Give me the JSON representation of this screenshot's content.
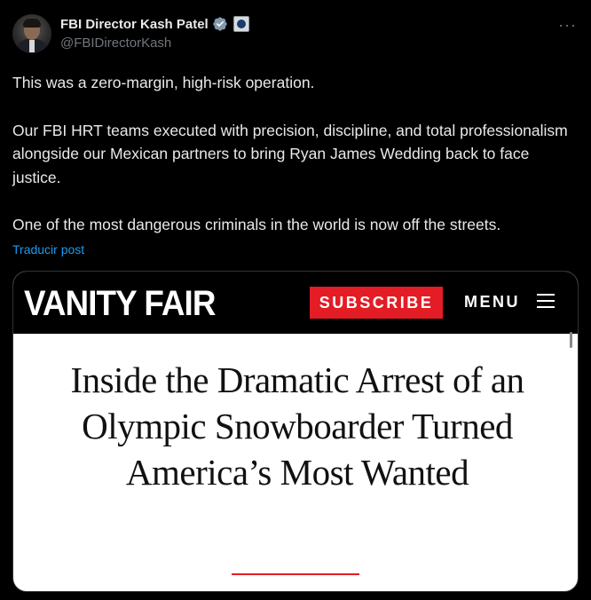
{
  "post": {
    "author": {
      "display_name": "FBI Director Kash Patel",
      "handle": "@FBIDirectorKash",
      "verified_icon": "verified-badge-icon",
      "affiliation_icon": "fbi-seal-icon"
    },
    "more_label": "···",
    "paragraphs": [
      "This was a zero-margin, high-risk operation.",
      "Our FBI HRT teams executed with precision, discipline, and total professionalism alongside our Mexican partners to bring Ryan James Wedding back to face justice.",
      "One of the most dangerous criminals in the world is now off the streets."
    ],
    "translate_label": "Traducir post"
  },
  "media": {
    "site_logo": "VANITY FAIR",
    "subscribe_label": "SUBSCRIBE",
    "menu_label": "MENU",
    "article_title": "Inside the Dramatic Arrest of an Olympic Snowboarder Turned America’s Most Wanted"
  },
  "colors": {
    "background": "#000000",
    "link": "#1d9bf0",
    "accent_red": "#e31c25",
    "muted": "#71767b"
  }
}
